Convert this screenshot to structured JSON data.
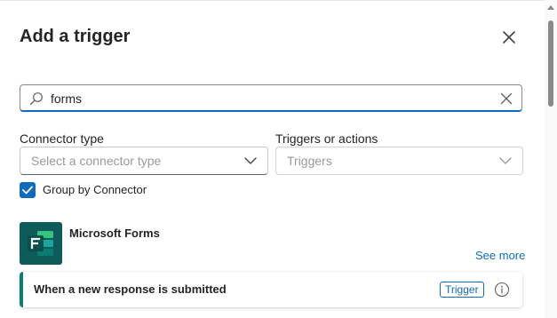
{
  "panel": {
    "title": "Add a trigger",
    "close_icon": "close-icon"
  },
  "search": {
    "value": "forms",
    "icon": "search-icon",
    "clear_icon": "clear-icon"
  },
  "filters": {
    "connector_type": {
      "label": "Connector type",
      "placeholder": "Select a connector type"
    },
    "triggers_or_actions": {
      "label": "Triggers or actions",
      "placeholder": "Triggers"
    }
  },
  "group_by": {
    "label": "Group by Connector",
    "checked": true
  },
  "connector": {
    "name": "Microsoft Forms",
    "logo_icon": "microsoft-forms-icon",
    "logo_color": "#0d5c5a",
    "see_more": "See more"
  },
  "operations": [
    {
      "name": "When a new response is submitted",
      "badge": "Trigger",
      "info_icon": "info-icon"
    }
  ],
  "colors": {
    "accent": "#0f6cbd",
    "forms_teal": "#0d7b76"
  }
}
